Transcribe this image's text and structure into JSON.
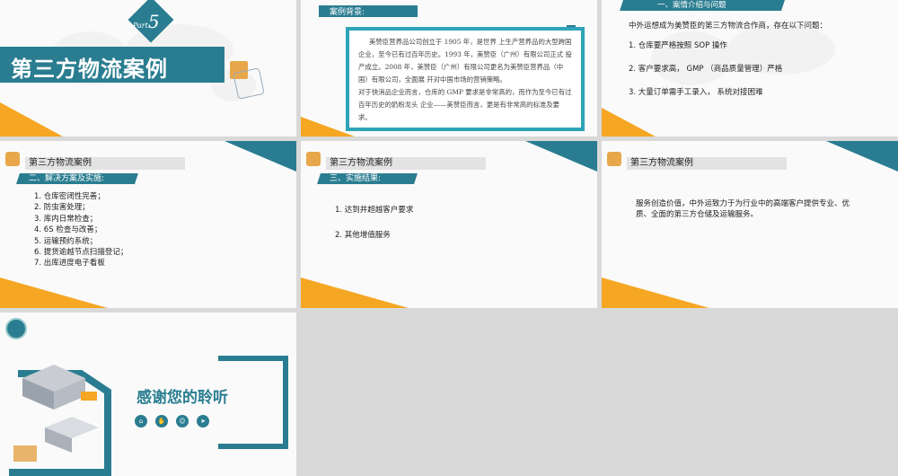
{
  "slide1": {
    "part_prefix": "Part",
    "part_number": "5",
    "title": "第三方物流案例"
  },
  "slide2": {
    "tab_label": "案例背景:",
    "paragraph1": "美赞臣营养品公司创立于 1905 年，是世界 上生产营养品的大型跨国企业，至今已有过百年历史。1993 年，美赞臣（广州）有限公司正式 投产成立。2008 年，美赞臣（广州）有限公司更名为美赞臣营养品（中国）有限公司，全面展 开对中国市场的营销策略。",
    "paragraph2": "对于快消品企业而言，仓库的 GMP 要求是非常高的，而作为至今已有过百年历史的奶粉龙头 企业——美赞臣而言，更是有非常高的标准及要求。"
  },
  "slide3": {
    "section_label": "一、案情介绍与问题",
    "intro": "中外运想成为美赞臣的第三方物流合作商，存在以下问题：",
    "items": [
      "1. 仓库要严格按照  SOP 操作",
      "2. 客户要求高，  GMP （商品质量管理）严格",
      "3. 大量订单需手工录入，  系统对接困难"
    ]
  },
  "slide4": {
    "header": "第三方物流案例",
    "section_label": "二、解决方案及实施:",
    "items": [
      "1. 仓库密闭性完善；",
      "2.  防虫害处理；",
      "3.  库内日常检查；",
      "4. 6S 检查与改善；",
      "5.  运输预约系统；",
      "6.  提货逾越节点扫描登记；",
      "7.  出库进度电子看板"
    ]
  },
  "slide5": {
    "header": "第三方物流案例",
    "section_label": "三、实施结果:",
    "items": [
      "1.   达到并超越客户要求",
      "2. 其他增值服务"
    ]
  },
  "slide6": {
    "header": "第三方物流案例",
    "body": "服务创造价值，中外运致力于为行业中的高端客户提供专业、优质、全面的第三方仓储及运输服务。"
  },
  "slide7": {
    "thanks": "感谢您的聆听"
  },
  "colors": {
    "teal": "#2a7d91",
    "orange": "#f5a623",
    "bright_teal": "#2fa4b8"
  }
}
